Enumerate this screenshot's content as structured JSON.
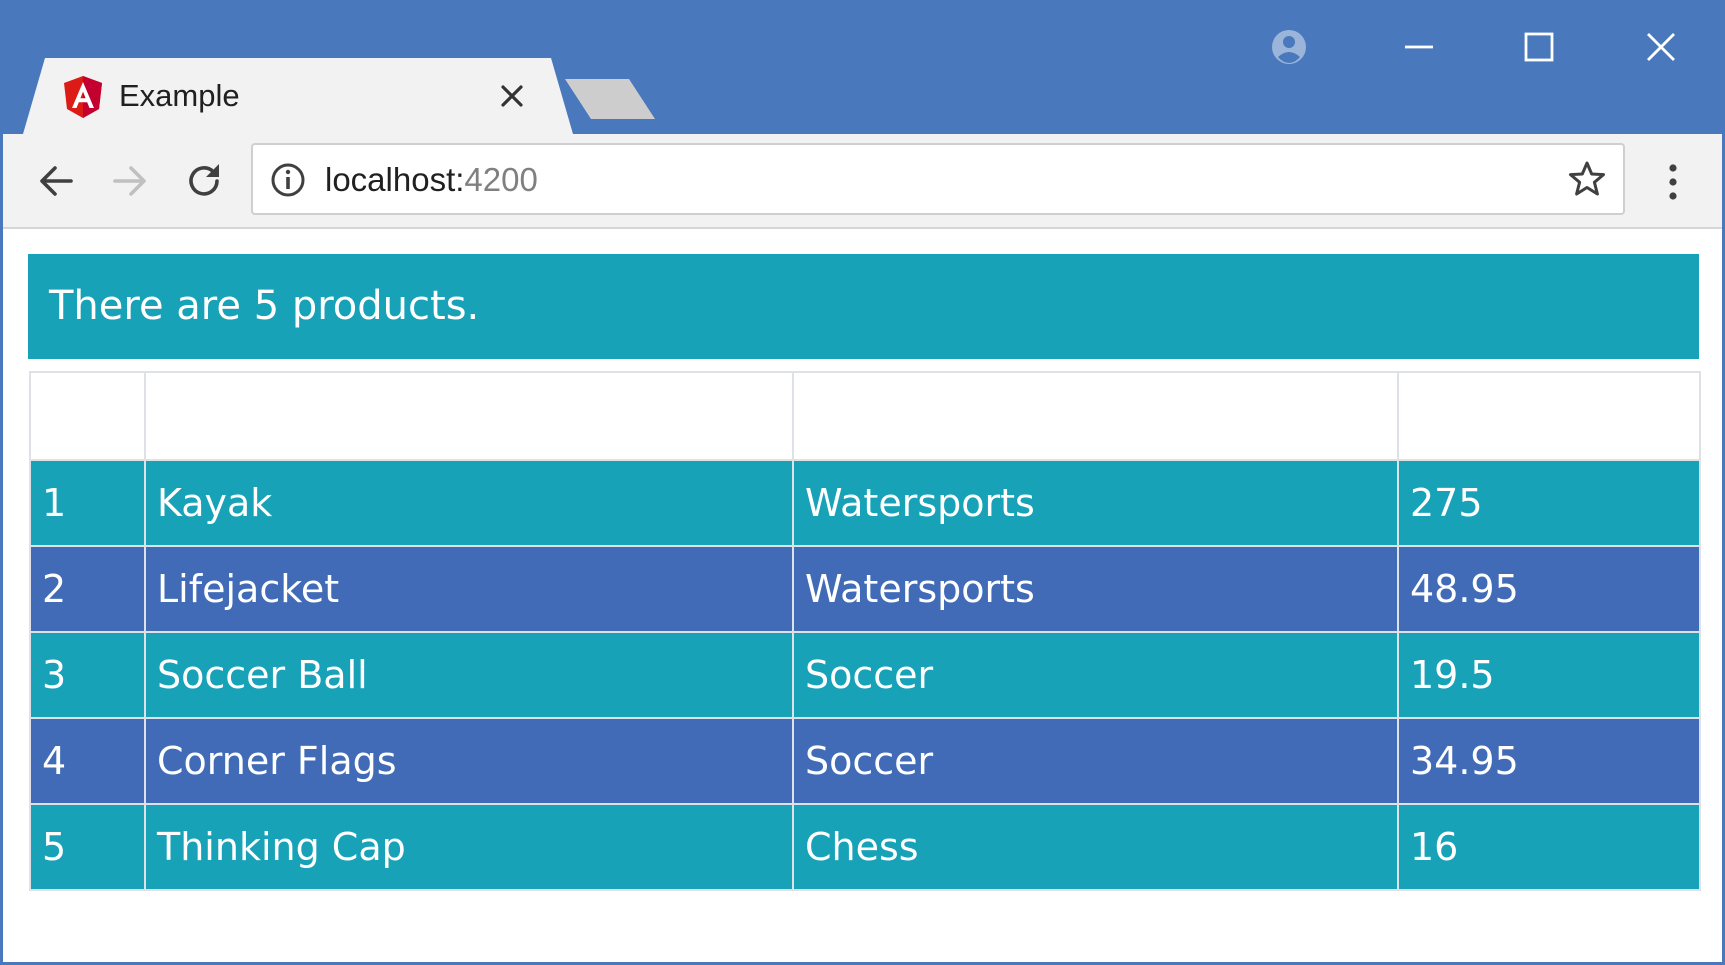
{
  "browser": {
    "tab": {
      "title": "Example",
      "icon": "angular-logo-icon"
    },
    "address_bar": {
      "host": "localhost:",
      "port": "4200"
    },
    "colors": {
      "frame": "#4a78bc",
      "toolbar": "#f2f2f2"
    }
  },
  "page": {
    "banner": {
      "text": "There are 5 products.",
      "color": "#17a2b8"
    },
    "table": {
      "headers": [
        "",
        "",
        "",
        ""
      ],
      "row_colors": [
        "#17a2b8",
        "#416bb7"
      ],
      "rows": [
        {
          "index": "1",
          "name": "Kayak",
          "category": "Watersports",
          "price": "275"
        },
        {
          "index": "2",
          "name": "Lifejacket",
          "category": "Watersports",
          "price": "48.95"
        },
        {
          "index": "3",
          "name": "Soccer Ball",
          "category": "Soccer",
          "price": "19.5"
        },
        {
          "index": "4",
          "name": "Corner Flags",
          "category": "Soccer",
          "price": "34.95"
        },
        {
          "index": "5",
          "name": "Thinking Cap",
          "category": "Chess",
          "price": "16"
        }
      ]
    }
  }
}
